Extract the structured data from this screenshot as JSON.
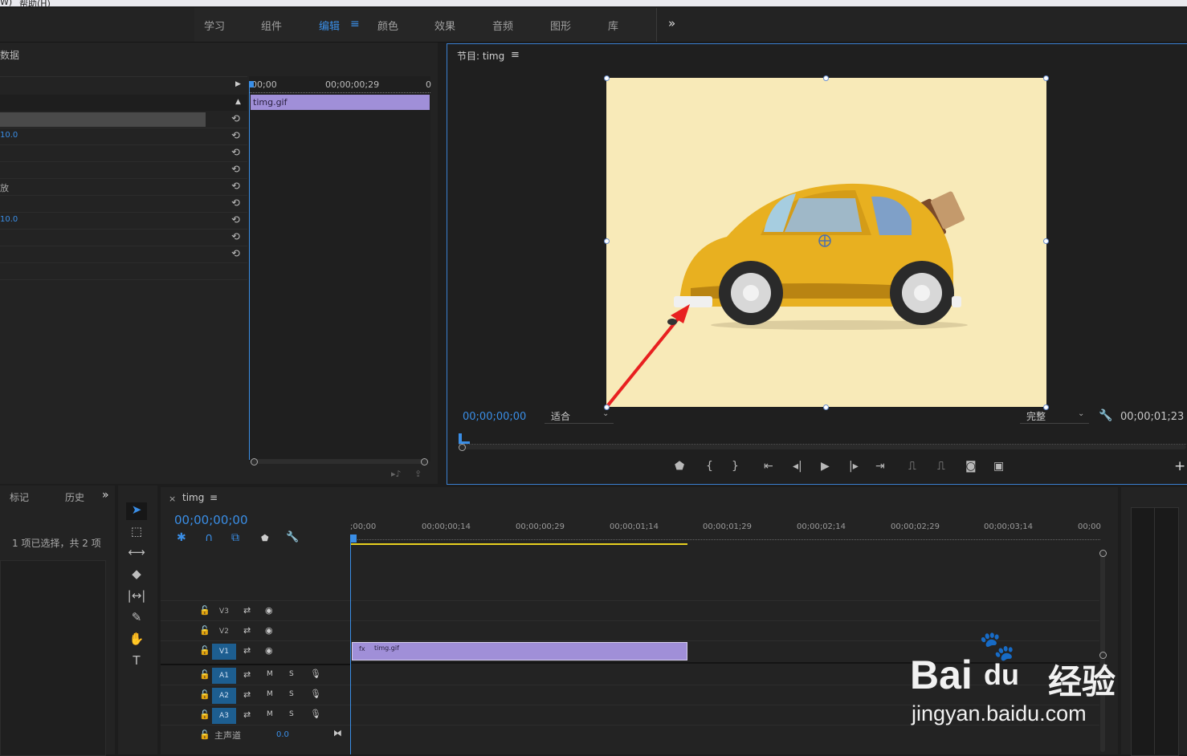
{
  "menu": {
    "items": [
      "W)",
      "帮助(H)"
    ]
  },
  "workspaces": {
    "items": [
      "学习",
      "组件",
      "编辑",
      "颜色",
      "效果",
      "音频",
      "图形",
      "库"
    ],
    "active": "编辑",
    "more": "»"
  },
  "effects": {
    "title_fragment": "数据",
    "ruler_start": "00;00",
    "ruler_mid": "00;00;00;29",
    "ruler_end": "0",
    "clip_name": "timg.gif",
    "rows": [
      {
        "value": ""
      },
      {
        "value": "10.0"
      },
      {
        "value": ""
      },
      {
        "value": ""
      },
      {
        "value": "放"
      },
      {
        "value": ""
      },
      {
        "value": "10.0"
      },
      {
        "value": ""
      },
      {
        "value": ""
      }
    ]
  },
  "program": {
    "title": "节目: timg",
    "timecode_current": "00;00;00;00",
    "fit_label": "适合",
    "quality_label": "完整",
    "timecode_duration": "00;00;01;23",
    "add_button": "+"
  },
  "lowerleft": {
    "tab_markers": "标记",
    "tab_history": "历史",
    "more": "»",
    "selection_info": "1 项已选择，共 2 项"
  },
  "timeline": {
    "sequence_name": "timg",
    "timecode": "00;00;00;00",
    "ruler": [
      ";00;00",
      "00;00;00;14",
      "00;00;00;29",
      "00;00;01;14",
      "00;00;01;29",
      "00;00;02;14",
      "00;00;02;29",
      "00;00;03;14",
      "00;00"
    ],
    "video_tracks": [
      "V3",
      "V2",
      "V1"
    ],
    "audio_tracks": [
      "A1",
      "A2",
      "A3"
    ],
    "mute_label": "M",
    "solo_label": "S",
    "master_label": "主声道",
    "master_value": "0.0",
    "clip_name": "timg.gif",
    "clip_color": "#a08fd8"
  },
  "watermark": {
    "brand": "Bai",
    "brand2": "du",
    "cn": "经验",
    "url": "jingyan.baidu.com"
  },
  "colors": {
    "accent": "#3a8ee6",
    "clip": "#a08fd8",
    "arrow": "#e82020",
    "car": "#e8b020"
  }
}
